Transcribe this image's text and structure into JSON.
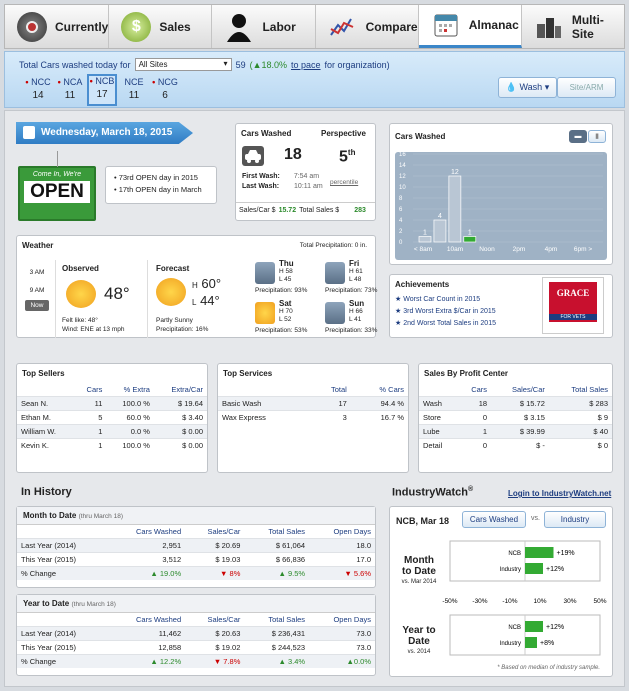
{
  "nav": {
    "tabs": [
      {
        "label": "Currently",
        "icon": "dial-icon"
      },
      {
        "label": "Sales",
        "icon": "money-icon"
      },
      {
        "label": "Labor",
        "icon": "person-icon"
      },
      {
        "label": "Compare",
        "icon": "trend-icon"
      },
      {
        "label": "Almanac",
        "icon": "calendar-icon"
      },
      {
        "label": "Multi-Site",
        "icon": "buildings-icon"
      }
    ],
    "active": "Almanac"
  },
  "summary": {
    "prefix": "Total Cars washed today for",
    "site_select": "All Sites",
    "count": "59",
    "change": "(▲18.0%",
    "pace_link": "to pace",
    "suffix": "for organization)",
    "sites": [
      {
        "code": "NCC",
        "value": "14"
      },
      {
        "code": "NCA",
        "value": "11"
      },
      {
        "code": "NCB",
        "value": "17"
      },
      {
        "code": "NCE",
        "value": "11"
      },
      {
        "code": "NCG",
        "value": "6"
      }
    ],
    "wash_btn": "Wash",
    "site_arm_btn": "Site/ARM"
  },
  "date": {
    "banner": "Wednesday, March 18, 2015",
    "sign_top": "Come In, We're",
    "sign_main": "OPEN",
    "notes": [
      "73rd OPEN day in 2015",
      "17th OPEN day in March"
    ]
  },
  "cars": {
    "title": "Cars Washed",
    "count": "18",
    "first_label": "First Wash:",
    "first_time": "7:54 am",
    "last_label": "Last Wash:",
    "last_time": "10:11 am",
    "perspective_title": "Perspective",
    "perspective_value": "5",
    "perspective_sup": "th",
    "perspective_unit": "percentile",
    "sales_label": "Sales/Car $",
    "sales_value": "15.72",
    "total_label": "Total Sales $",
    "total_value": "283"
  },
  "chart_data": {
    "type": "bar",
    "title": "Cars Washed",
    "categories": [
      "< 8am",
      "8am",
      "10am",
      "Noon",
      "2pm",
      "4pm",
      "6pm >"
    ],
    "values": [
      1,
      4,
      12,
      1,
      0,
      0,
      0
    ],
    "ylim": [
      0,
      16
    ],
    "yticks": [
      "0",
      "2",
      "4",
      "6",
      "8",
      "10",
      "12",
      "14",
      "16"
    ],
    "xlabels": [
      "< 8am",
      "10am",
      "Noon",
      "2pm",
      "4pm",
      "6pm >"
    ],
    "bar_labels": [
      "1",
      "4",
      "12",
      "1"
    ],
    "colors": {
      "bar": "#b9c6d4",
      "current": "#33aa33",
      "plot_bg": "#9fb2c5"
    }
  },
  "weather": {
    "title": "Weather",
    "precip_total": "Total Precipitation: 0 in.",
    "times": [
      "3 AM",
      "9 AM",
      "Now"
    ],
    "observed_title": "Observed",
    "observed_temp": "48°",
    "feels": "Felt like: 48°",
    "wind": "Wind: ENE at 13 mph",
    "forecast_title": "Forecast",
    "high_label": "H",
    "high": "60°",
    "low_label": "L",
    "low": "44°",
    "forecast_desc": "Partly Sunny",
    "forecast_precip": "Precipitation: 16%",
    "days": [
      {
        "day": "Thu",
        "h": "H 58",
        "l": "L 45",
        "p": "Precipitation: 93%",
        "icon": "rain-icon"
      },
      {
        "day": "Fri",
        "h": "H 61",
        "l": "L 48",
        "p": "Precipitation: 73%",
        "icon": "rain-icon"
      },
      {
        "day": "Sat",
        "h": "H 70",
        "l": "L 52",
        "p": "Precipitation: 53%",
        "icon": "partly-sunny-icon"
      },
      {
        "day": "Sun",
        "h": "H 66",
        "l": "L 41",
        "p": "Precipitation: 33%",
        "icon": "rain-icon"
      }
    ]
  },
  "achievements": {
    "title": "Achievements",
    "items": [
      "Worst Car Count in 2015",
      "3rd Worst Extra $/Car in 2015",
      "2nd Worst Total Sales in 2015"
    ],
    "logo_text": "GRACE",
    "logo_sub": "FOR VETS"
  },
  "top_sellers": {
    "title": "Top Sellers",
    "cols": [
      "",
      "Cars",
      "% Extra",
      "Extra/Car"
    ],
    "rows": [
      [
        "Sean N.",
        "11",
        "100.0 %",
        "$",
        "19.64"
      ],
      [
        "Ethan M.",
        "5",
        "60.0 %",
        "$",
        "3.40"
      ],
      [
        "William W.",
        "1",
        "0.0 %",
        "$",
        "0.00"
      ],
      [
        "Kevin K.",
        "1",
        "100.0 %",
        "$",
        "0.00"
      ]
    ]
  },
  "top_services": {
    "title": "Top Services",
    "cols": [
      "",
      "Total",
      "% Cars"
    ],
    "rows": [
      [
        "Basic Wash",
        "17",
        "94.4 %"
      ],
      [
        "Wax Express",
        "3",
        "16.7 %"
      ]
    ]
  },
  "profit": {
    "title": "Sales By Profit Center",
    "cols": [
      "",
      "Cars",
      "Sales/Car",
      "Total Sales"
    ],
    "rows": [
      [
        "Wash",
        "18",
        "$",
        "15.72",
        "$",
        "283"
      ],
      [
        "Store",
        "0",
        "$",
        "3.15",
        "$",
        "9"
      ],
      [
        "Lube",
        "1",
        "$",
        "39.99",
        "$",
        "40"
      ],
      [
        "Detail",
        "0",
        "$",
        "-",
        "$",
        "0"
      ]
    ]
  },
  "history": {
    "title": "In History",
    "month": {
      "title": "Month to Date",
      "sub": "(thru March 18)",
      "cols": [
        "",
        "Cars Washed",
        "Sales/Car",
        "Total Sales",
        "Open Days"
      ],
      "rows": [
        [
          "Last Year (2014)",
          "2,951",
          "$",
          "20.69",
          "$",
          "61,064",
          "18.0"
        ],
        [
          "This Year (2015)",
          "3,512",
          "$",
          "19.03",
          "$",
          "66,836",
          "17.0"
        ]
      ],
      "change": [
        "% Change",
        "▲ 19.0%",
        "▼ 8%",
        "▲ 9.5%",
        "▼ 5.6%"
      ]
    },
    "year": {
      "title": "Year to Date",
      "sub": "(thru March 18)",
      "cols": [
        "",
        "Cars Washed",
        "Sales/Car",
        "Total Sales",
        "Open Days"
      ],
      "rows": [
        [
          "Last Year (2014)",
          "11,462",
          "$",
          "20.63",
          "$",
          "236,431",
          "73.0"
        ],
        [
          "This Year (2015)",
          "12,858",
          "$",
          "19.02",
          "$",
          "244,523",
          "73.0"
        ]
      ],
      "change": [
        "% Change",
        "▲ 12.2%",
        "▼ 7.8%",
        "▲ 3.4%",
        "▲0.0%"
      ]
    }
  },
  "industry": {
    "title": "IndustryWatch",
    "reg": "®",
    "login": "Login to IndustryWatch.net",
    "site_date": "NCB, Mar 18",
    "btn_cars": "Cars Washed",
    "vs": "vs.",
    "btn_industry": "Industry",
    "month_label": "Month to Date",
    "month_sub": "vs. Mar 2014",
    "year_label": "Year to Date",
    "year_sub": "vs. 2014",
    "axis": [
      "-50%",
      "-30%",
      "-10%",
      "10%",
      "30%",
      "50%"
    ],
    "month_bars": [
      {
        "name": "NCB",
        "value": 19,
        "label": "+19%"
      },
      {
        "name": "Industry",
        "value": 12,
        "label": "+12%"
      }
    ],
    "year_bars": [
      {
        "name": "NCB",
        "value": 12,
        "label": "+12%"
      },
      {
        "name": "Industry",
        "value": 8,
        "label": "+8%"
      }
    ],
    "footnote": "* Based on median of industry sample."
  }
}
